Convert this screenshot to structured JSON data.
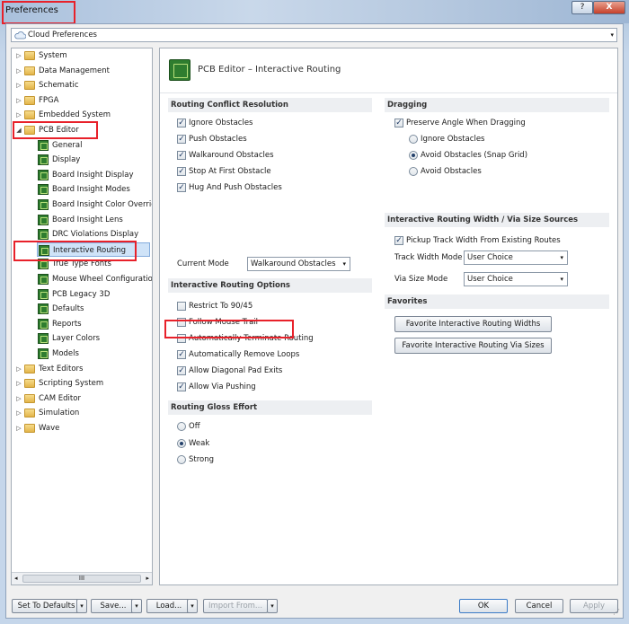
{
  "window": {
    "title": "Preferences",
    "help_label": "?",
    "close_label": "X"
  },
  "cloud": {
    "label": "Cloud Preferences",
    "arrow": "▾",
    "icon": "cloud-icon"
  },
  "tree": {
    "items": [
      {
        "label": "System",
        "twist": "▷",
        "kind": "folder"
      },
      {
        "label": "Data Management",
        "twist": "▷",
        "kind": "folder"
      },
      {
        "label": "Schematic",
        "twist": "▷",
        "kind": "folder"
      },
      {
        "label": "FPGA",
        "twist": "▷",
        "kind": "folder"
      },
      {
        "label": "Embedded System",
        "twist": "▷",
        "kind": "folder"
      },
      {
        "label": "PCB Editor",
        "twist": "◢",
        "kind": "folder-open"
      },
      {
        "label": "General",
        "kind": "pcb"
      },
      {
        "label": "Display",
        "kind": "pcb"
      },
      {
        "label": "Board Insight Display",
        "kind": "pcb"
      },
      {
        "label": "Board Insight Modes",
        "kind": "pcb"
      },
      {
        "label": "Board Insight Color Overrid",
        "kind": "pcb"
      },
      {
        "label": "Board Insight Lens",
        "kind": "pcb"
      },
      {
        "label": "DRC Violations Display",
        "kind": "pcb"
      },
      {
        "label": "Interactive Routing",
        "kind": "pcb",
        "selected": true
      },
      {
        "label": "True Type Fonts",
        "kind": "pcb"
      },
      {
        "label": "Mouse Wheel Configuration",
        "kind": "pcb"
      },
      {
        "label": "PCB Legacy 3D",
        "kind": "pcb"
      },
      {
        "label": "Defaults",
        "kind": "pcb"
      },
      {
        "label": "Reports",
        "kind": "pcb"
      },
      {
        "label": "Layer Colors",
        "kind": "pcb"
      },
      {
        "label": "Models",
        "kind": "pcb"
      },
      {
        "label": "Text Editors",
        "twist": "▷",
        "kind": "folder"
      },
      {
        "label": "Scripting System",
        "twist": "▷",
        "kind": "folder"
      },
      {
        "label": "CAM Editor",
        "twist": "▷",
        "kind": "folder"
      },
      {
        "label": "Simulation",
        "twist": "▷",
        "kind": "folder"
      },
      {
        "label": "Wave",
        "twist": "▷",
        "kind": "folder"
      }
    ],
    "scroll_left": "◂",
    "scroll_right": "▸",
    "scroll_thumb": "III"
  },
  "panel": {
    "title": "PCB Editor – Interactive Routing",
    "conflict": {
      "heading": "Routing Conflict Resolution",
      "options": [
        {
          "label": "Ignore Obstacles",
          "checked": true
        },
        {
          "label": "Push Obstacles",
          "checked": true
        },
        {
          "label": "Walkaround Obstacles",
          "checked": true
        },
        {
          "label": "Stop At First Obstacle",
          "checked": true
        },
        {
          "label": "Hug And Push Obstacles",
          "checked": true
        }
      ],
      "current_mode_label": "Current Mode",
      "current_mode_value": "Walkaround Obstacles"
    },
    "routing_options": {
      "heading": "Interactive Routing Options",
      "options": [
        {
          "label": "Restrict To 90/45",
          "checked": false
        },
        {
          "label": "Follow Mouse Trail",
          "checked": false
        },
        {
          "label": "Automatically Terminate Routing",
          "checked": false
        },
        {
          "label": "Automatically Remove Loops",
          "checked": true
        },
        {
          "label": "Allow Diagonal Pad Exits",
          "checked": true
        },
        {
          "label": "Allow Via Pushing",
          "checked": true
        }
      ]
    },
    "gloss": {
      "heading": "Routing Gloss Effort",
      "options": [
        {
          "label": "Off",
          "selected": false
        },
        {
          "label": "Weak",
          "selected": true
        },
        {
          "label": "Strong",
          "selected": false
        }
      ]
    },
    "dragging": {
      "heading": "Dragging",
      "preserve_label": "Preserve Angle When Dragging",
      "preserve_checked": true,
      "options": [
        {
          "label": "Ignore Obstacles",
          "selected": false
        },
        {
          "label": "Avoid Obstacles (Snap Grid)",
          "selected": true
        },
        {
          "label": "Avoid Obstacles",
          "selected": false
        }
      ]
    },
    "width_sources": {
      "heading": "Interactive Routing Width / Via Size Sources",
      "pickup_label": "Pickup Track Width From Existing Routes",
      "pickup_checked": true,
      "track_mode_label": "Track Width Mode",
      "track_mode_value": "User Choice",
      "via_mode_label": "Via Size Mode",
      "via_mode_value": "User Choice"
    },
    "favorites": {
      "heading": "Favorites",
      "widths_button": "Favorite Interactive Routing Widths",
      "vias_button": "Favorite Interactive Routing Via Sizes"
    }
  },
  "footer": {
    "set_defaults": "Set To Defaults",
    "save": "Save...",
    "load": "Load...",
    "import": "Import From...",
    "ok": "OK",
    "cancel": "Cancel",
    "apply": "Apply",
    "dropdown_arrow": "▾",
    "grip": "⋰"
  },
  "colors": {
    "highlight": "#e8212a",
    "selection": "#cfe3f8"
  }
}
